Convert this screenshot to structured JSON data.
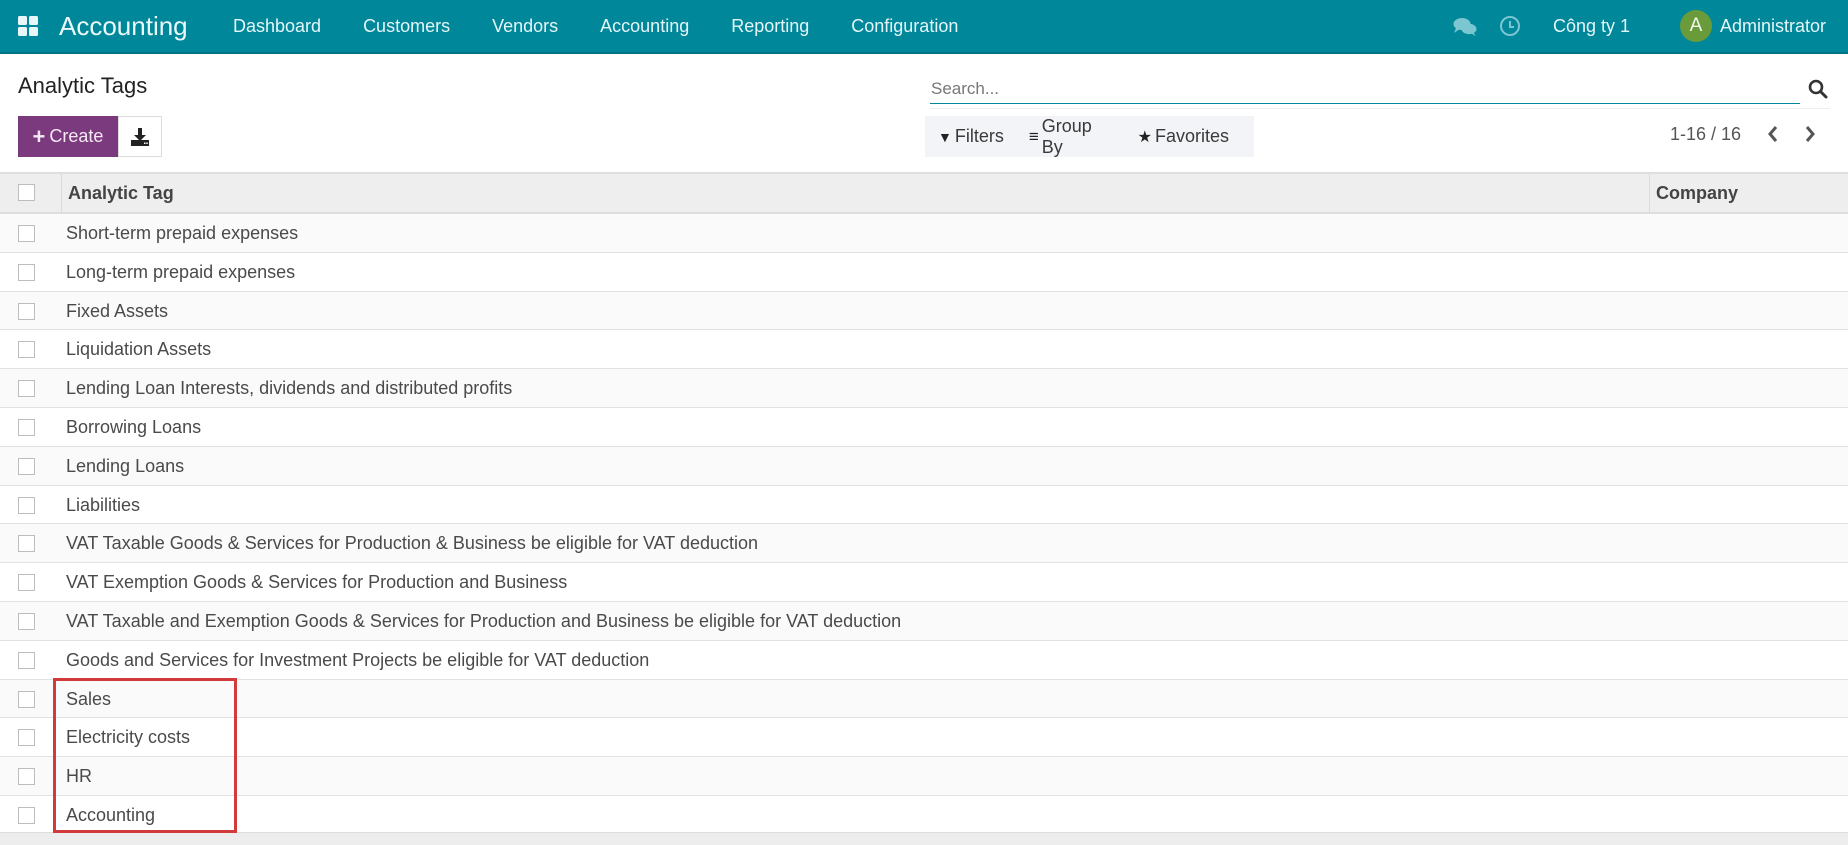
{
  "navbar": {
    "app_icon": "apps-grid-icon",
    "brand": "Accounting",
    "menu": [
      {
        "label": "Dashboard"
      },
      {
        "label": "Customers"
      },
      {
        "label": "Vendors"
      },
      {
        "label": "Accounting"
      },
      {
        "label": "Reporting"
      },
      {
        "label": "Configuration"
      }
    ],
    "chat_icon": "chat-icon",
    "activity_icon": "clock-icon",
    "company": "Công ty 1",
    "user": {
      "avatar_letter": "A",
      "name": "Administrator",
      "avatar_color": "#6a9b3a"
    }
  },
  "control_panel": {
    "title": "Analytic Tags",
    "create_label": "Create",
    "create_icon": "+",
    "download_icon": "download-icon",
    "search": {
      "placeholder": "Search...",
      "value": ""
    },
    "filters_label": "Filters",
    "groupby_label": "Group By",
    "favorites_label": "Favorites",
    "pager": {
      "range": "1-16 / 16"
    }
  },
  "table": {
    "columns": [
      "Analytic Tag",
      "Company"
    ],
    "rows": [
      {
        "name": "Short-term prepaid expenses",
        "company": ""
      },
      {
        "name": "Long-term prepaid expenses",
        "company": ""
      },
      {
        "name": "Fixed Assets",
        "company": ""
      },
      {
        "name": "Liquidation Assets",
        "company": ""
      },
      {
        "name": "Lending Loan Interests, dividends and distributed profits",
        "company": ""
      },
      {
        "name": "Borrowing Loans",
        "company": ""
      },
      {
        "name": "Lending Loans",
        "company": ""
      },
      {
        "name": "Liabilities",
        "company": ""
      },
      {
        "name": "VAT Taxable Goods & Services for Production & Business be eligible for VAT deduction",
        "company": ""
      },
      {
        "name": "VAT Exemption Goods & Services for Production and Business",
        "company": ""
      },
      {
        "name": "VAT Taxable and Exemption Goods & Services for Production and Business be eligible for VAT deduction",
        "company": ""
      },
      {
        "name": "Goods and Services for Investment Projects be eligible for VAT deduction",
        "company": ""
      },
      {
        "name": "Sales",
        "company": ""
      },
      {
        "name": "Electricity costs",
        "company": ""
      },
      {
        "name": "HR",
        "company": ""
      },
      {
        "name": "Accounting",
        "company": ""
      }
    ]
  },
  "colors": {
    "navbar": "#00879a",
    "primary_button": "#7c3a7e",
    "highlight": "#d13b3b"
  }
}
